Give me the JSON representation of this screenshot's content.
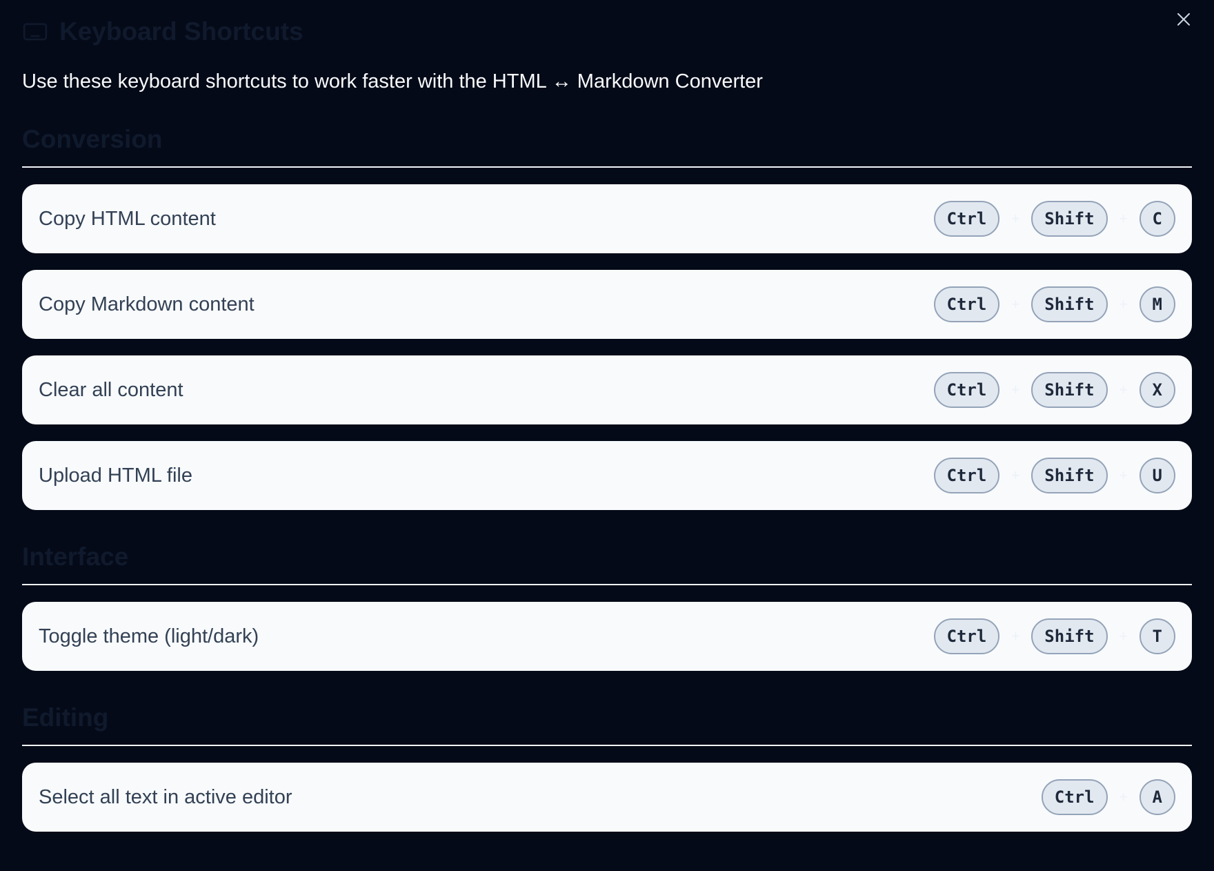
{
  "dialog": {
    "title": "Keyboard Shortcuts",
    "description": "Use these keyboard shortcuts to work faster with the HTML ↔ Markdown Converter",
    "title_icon": "keyboard-icon",
    "close_icon": "close-icon"
  },
  "sections": [
    {
      "title": "Conversion",
      "shortcuts": [
        {
          "label": "Copy HTML content",
          "keys": [
            "Ctrl",
            "Shift",
            "C"
          ]
        },
        {
          "label": "Copy Markdown content",
          "keys": [
            "Ctrl",
            "Shift",
            "M"
          ]
        },
        {
          "label": "Clear all content",
          "keys": [
            "Ctrl",
            "Shift",
            "X"
          ]
        },
        {
          "label": "Upload HTML file",
          "keys": [
            "Ctrl",
            "Shift",
            "U"
          ]
        }
      ]
    },
    {
      "title": "Interface",
      "shortcuts": [
        {
          "label": "Toggle theme (light/dark)",
          "keys": [
            "Ctrl",
            "Shift",
            "T"
          ]
        }
      ]
    },
    {
      "title": "Editing",
      "shortcuts": [
        {
          "label": "Select all text in active editor",
          "keys": [
            "Ctrl",
            "A"
          ]
        }
      ]
    }
  ],
  "key_separator": "+",
  "colors": {
    "background": "#050a18",
    "row_background": "#f8fafc",
    "key_background": "#e2e8f0",
    "key_border": "#94a3b8",
    "description_text": "#f8fafc",
    "faded_heading": "#101a2d"
  }
}
